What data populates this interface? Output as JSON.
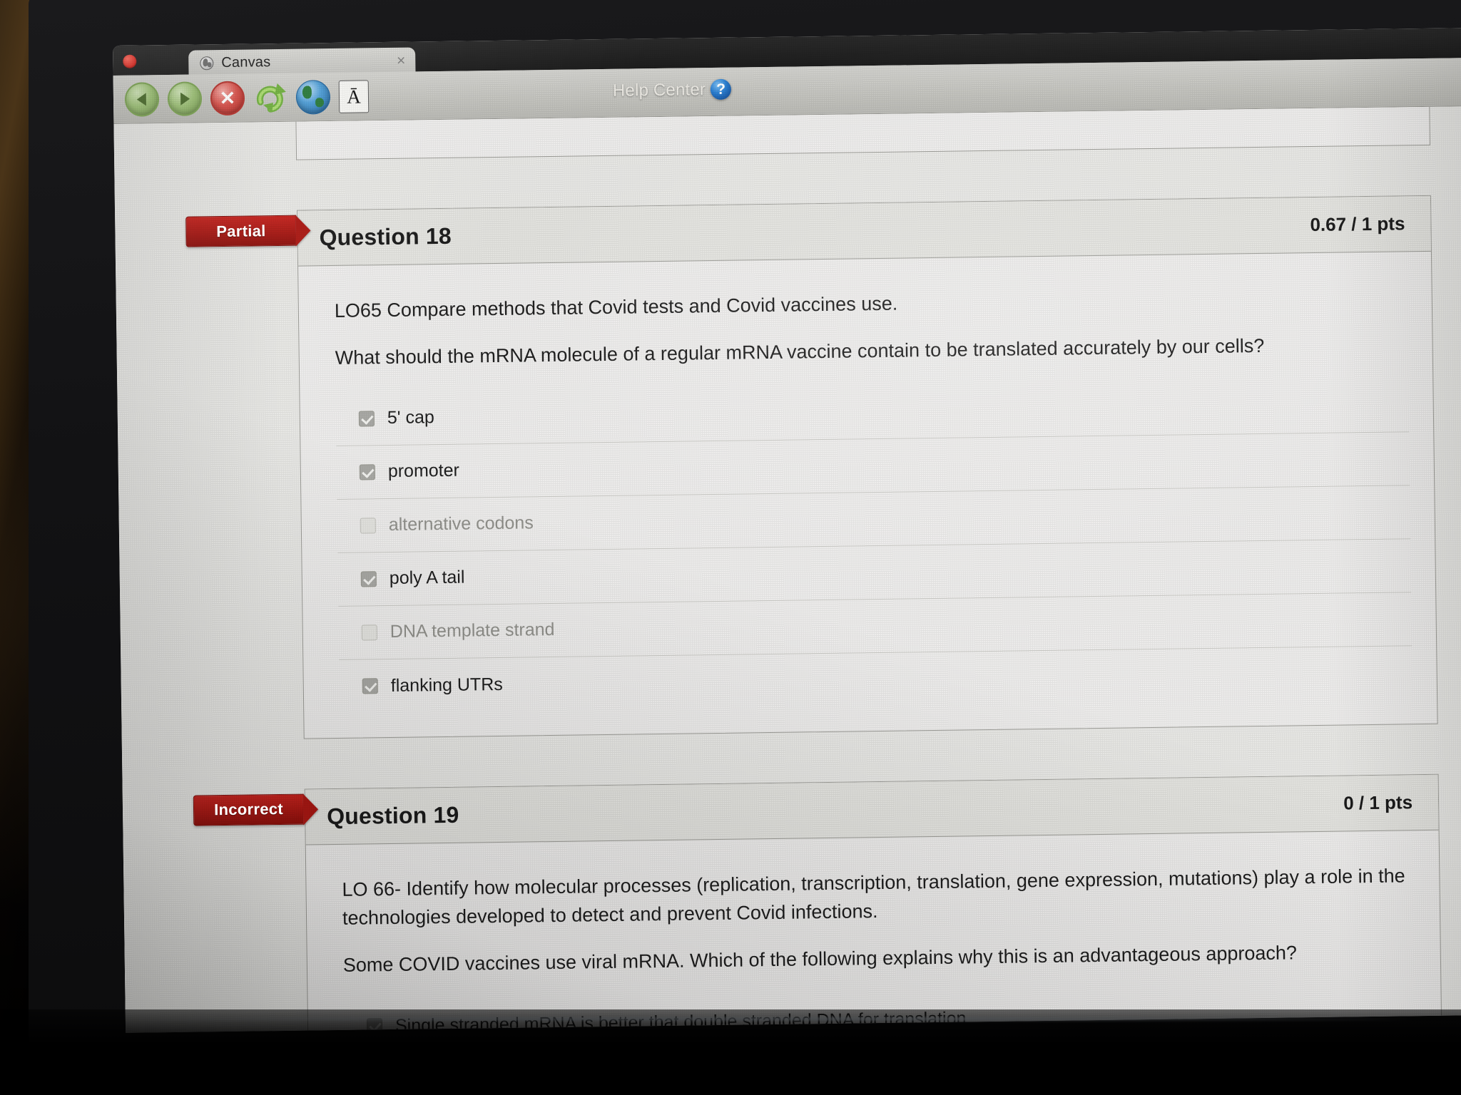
{
  "browser": {
    "window_dot": "close-dot",
    "tab": {
      "title": "Canvas",
      "favicon": "globe-icon",
      "close": "×"
    },
    "toolbar": {
      "back": "back-icon",
      "forward": "forward-icon",
      "stop": "✕",
      "reload": "reload-icon",
      "home": "globe-home-icon",
      "text_size": "Ā",
      "help_center_label": "Help Center",
      "help_center_icon": "?"
    }
  },
  "colors": {
    "badge_red": "#a81712",
    "page_bg": "#e7e7e4",
    "box_bg": "#edeceb",
    "header_bg": "#e3e3df",
    "border": "#9d9d98",
    "text": "#1e1e1e",
    "dim_text": "#90908b",
    "help_blue": "#2b7fd1"
  },
  "questions": [
    {
      "status": "Partial",
      "title": "Question 18",
      "points": "0.67 / 1 pts",
      "paragraphs": [
        "LO65 Compare methods that Covid tests and Covid vaccines use.",
        "What should the mRNA molecule of a regular mRNA vaccine  contain to be translated accurately by our cells?"
      ],
      "answers": [
        {
          "label": "5' cap",
          "checked": true
        },
        {
          "label": "promoter",
          "checked": true
        },
        {
          "label": "alternative codons",
          "checked": false
        },
        {
          "label": "poly A tail",
          "checked": true
        },
        {
          "label": "DNA template strand",
          "checked": false
        },
        {
          "label": "flanking UTRs",
          "checked": true
        }
      ]
    },
    {
      "status": "Incorrect",
      "title": "Question 19",
      "points": "0 / 1 pts",
      "paragraphs": [
        "LO 66- Identify how molecular processes (replication, transcription, translation, gene expression, mutations) play a role in the technologies developed to detect and prevent Covid infections.",
        "Some COVID vaccines use viral mRNA. Which of the following explains why this is an advantageous approach?"
      ],
      "answers": [
        {
          "label": "Single stranded mRNA is better that double stranded DNA for translation",
          "checked": true
        }
      ]
    }
  ]
}
